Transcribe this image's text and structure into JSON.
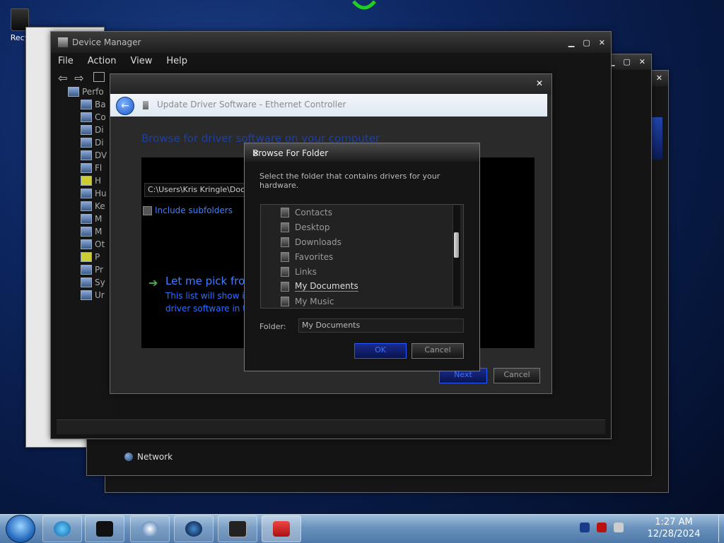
{
  "desktop": {
    "recycle_label": "Recy"
  },
  "device_manager": {
    "title": "Device Manager",
    "menu": [
      "File",
      "Action",
      "View",
      "Help"
    ],
    "tree_root": "Perfo",
    "tree_items": [
      "Ba",
      "Co",
      "Di",
      "Di",
      "DV",
      "Fl",
      "H",
      "Hu",
      "Ke",
      "M",
      "M",
      "Ot",
      "P",
      "Pr",
      "Sy",
      "Ur"
    ]
  },
  "update_driver": {
    "title": "Update Driver Software - Ethernet Controller",
    "heading": "Browse for driver software on your computer",
    "path_value": "C:\\Users\\Kris Kringle\\Docu",
    "include_subfolders": "Include subfolders",
    "let_me_pick": "Let me pick fron",
    "let_me_desc_1": "This list will show in",
    "let_me_desc_2": "driver software in th",
    "next_label": "Next",
    "cancel_label": "Cancel"
  },
  "browse_folder": {
    "title": "Browse For Folder",
    "message": "Select the folder that contains drivers for your hardware.",
    "items": [
      "Contacts",
      "Desktop",
      "Downloads",
      "Favorites",
      "Links",
      "My Documents",
      "My Music"
    ],
    "selected": "My Documents",
    "folder_label": "Folder:",
    "folder_value": "My Documents",
    "ok_label": "OK",
    "cancel_label": "Cancel"
  },
  "network": {
    "label": "Network"
  },
  "taskbar": {
    "time": "1:27 AM",
    "date": "12/28/2024",
    "buttons": [
      "ie-icon",
      "media-center-icon",
      "media-player-icon",
      "globe-icon",
      "monitor-icon",
      "toolbox-icon"
    ]
  },
  "colors": {
    "accent_blue": "#2f6fff",
    "taskbar": "#6a92bd"
  }
}
